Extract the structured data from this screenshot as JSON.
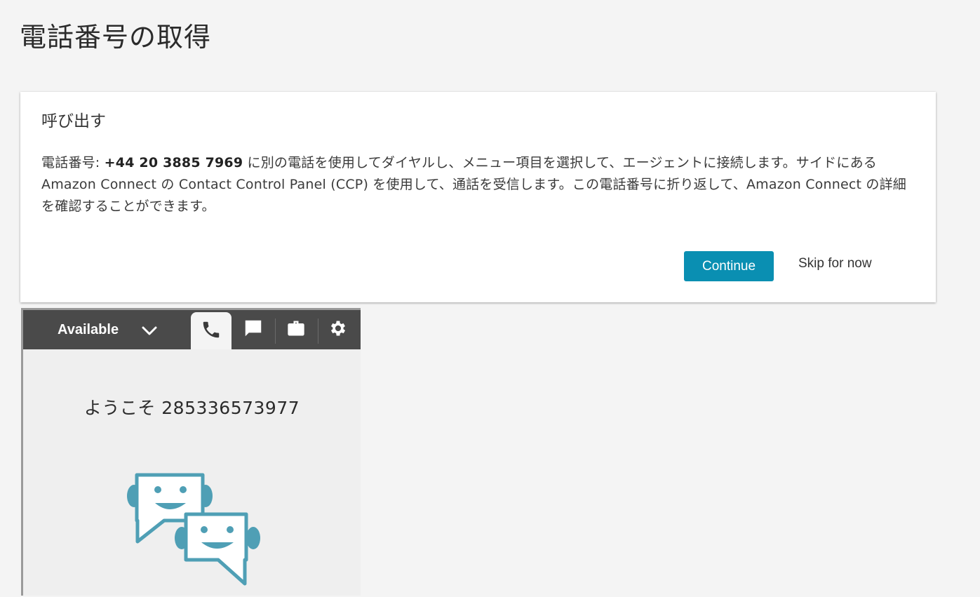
{
  "page": {
    "title": "電話番号の取得"
  },
  "call_card": {
    "title": "呼び出す",
    "body_prefix": "電話番号: ",
    "phone_number": "+44 20 3885 7969",
    "body_suffix": " に別の電話を使用してダイヤルし、メニュー項目を選択して、エージェントに接続します。サイドにある Amazon Connect の Contact Control Panel (CCP) を使用して、通話を受信します。この電話番号に折り返して、Amazon Connect の詳細を確認することができます。",
    "continue_label": "Continue",
    "skip_label": "Skip for now"
  },
  "ccp": {
    "status_label": "Available",
    "tabs": [
      {
        "icon": "phone-icon",
        "active": true
      },
      {
        "icon": "chat-icon",
        "active": false
      },
      {
        "icon": "briefcase-icon",
        "active": false
      },
      {
        "icon": "gear-icon",
        "active": false
      }
    ],
    "welcome_text": "ようこそ 285336573977"
  },
  "colors": {
    "accent": "#0a8fb2",
    "bar": "#4a4a4a",
    "illustration": "#4f9fb5"
  }
}
